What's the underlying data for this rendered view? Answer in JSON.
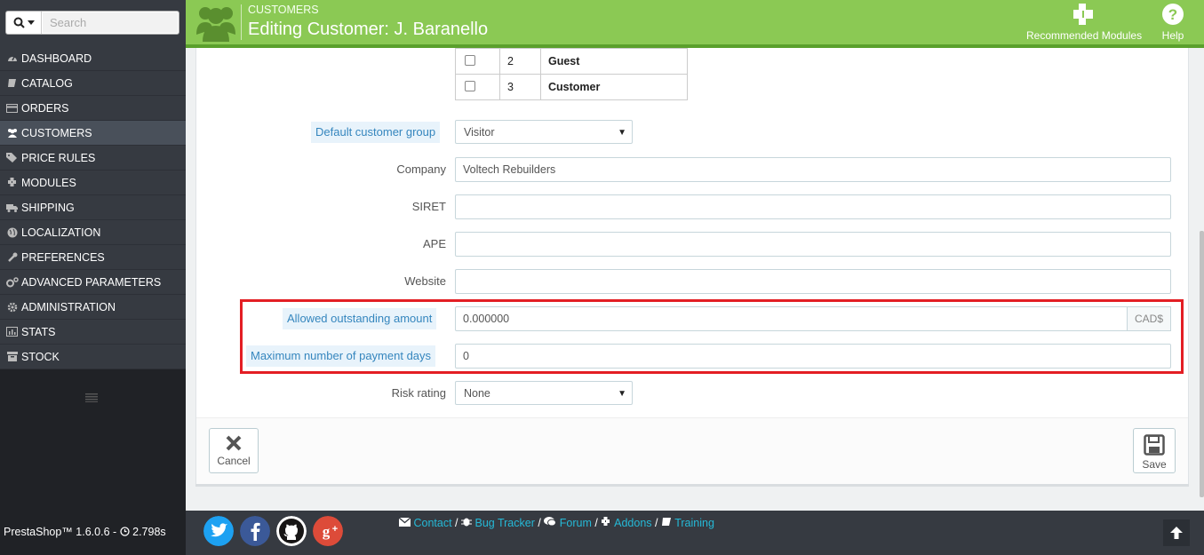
{
  "sidebar": {
    "search_placeholder": "Search",
    "items": [
      {
        "label": "DASHBOARD",
        "icon": "dashboard-icon"
      },
      {
        "label": "CATALOG",
        "icon": "book-icon"
      },
      {
        "label": "ORDERS",
        "icon": "credit-card-icon"
      },
      {
        "label": "CUSTOMERS",
        "icon": "users-icon"
      },
      {
        "label": "PRICE RULES",
        "icon": "tags-icon"
      },
      {
        "label": "MODULES",
        "icon": "puzzle-icon"
      },
      {
        "label": "SHIPPING",
        "icon": "truck-icon"
      },
      {
        "label": "LOCALIZATION",
        "icon": "globe-icon"
      },
      {
        "label": "PREFERENCES",
        "icon": "wrench-icon"
      },
      {
        "label": "ADVANCED PARAMETERS",
        "icon": "cogs-icon"
      },
      {
        "label": "ADMINISTRATION",
        "icon": "cog-icon"
      },
      {
        "label": "STATS",
        "icon": "bar-chart-icon"
      },
      {
        "label": "STOCK",
        "icon": "archive-icon"
      }
    ]
  },
  "header": {
    "breadcrumb": "CUSTOMERS",
    "title": "Editing Customer: J. Baranello",
    "recommended_modules": "Recommended Modules",
    "help": "Help"
  },
  "groups": [
    {
      "id": "2",
      "name": "Guest"
    },
    {
      "id": "3",
      "name": "Customer"
    }
  ],
  "form": {
    "default_group_label": "Default customer group",
    "default_group_value": "Visitor",
    "company_label": "Company",
    "company_value": "Voltech Rebuilders",
    "siret_label": "SIRET",
    "ape_label": "APE",
    "website_label": "Website",
    "outstanding_label": "Allowed outstanding amount",
    "outstanding_value": "0.000000",
    "outstanding_currency": "CAD$",
    "payment_days_label": "Maximum number of payment days",
    "payment_days_value": "0",
    "risk_label": "Risk rating",
    "risk_value": "None"
  },
  "actions": {
    "cancel": "Cancel",
    "save": "Save"
  },
  "footer": {
    "version": "PrestaShop™ 1.6.0.6 - ",
    "load_time": "2.798s",
    "links": {
      "contact": "Contact",
      "bug_tracker": "Bug Tracker",
      "forum": "Forum",
      "addons": "Addons",
      "training": "Training"
    }
  },
  "colors": {
    "header_green": "#8bc954",
    "sidebar": "#363a41",
    "highlight_red": "#e31e24",
    "link_blue": "#25b9d7"
  }
}
